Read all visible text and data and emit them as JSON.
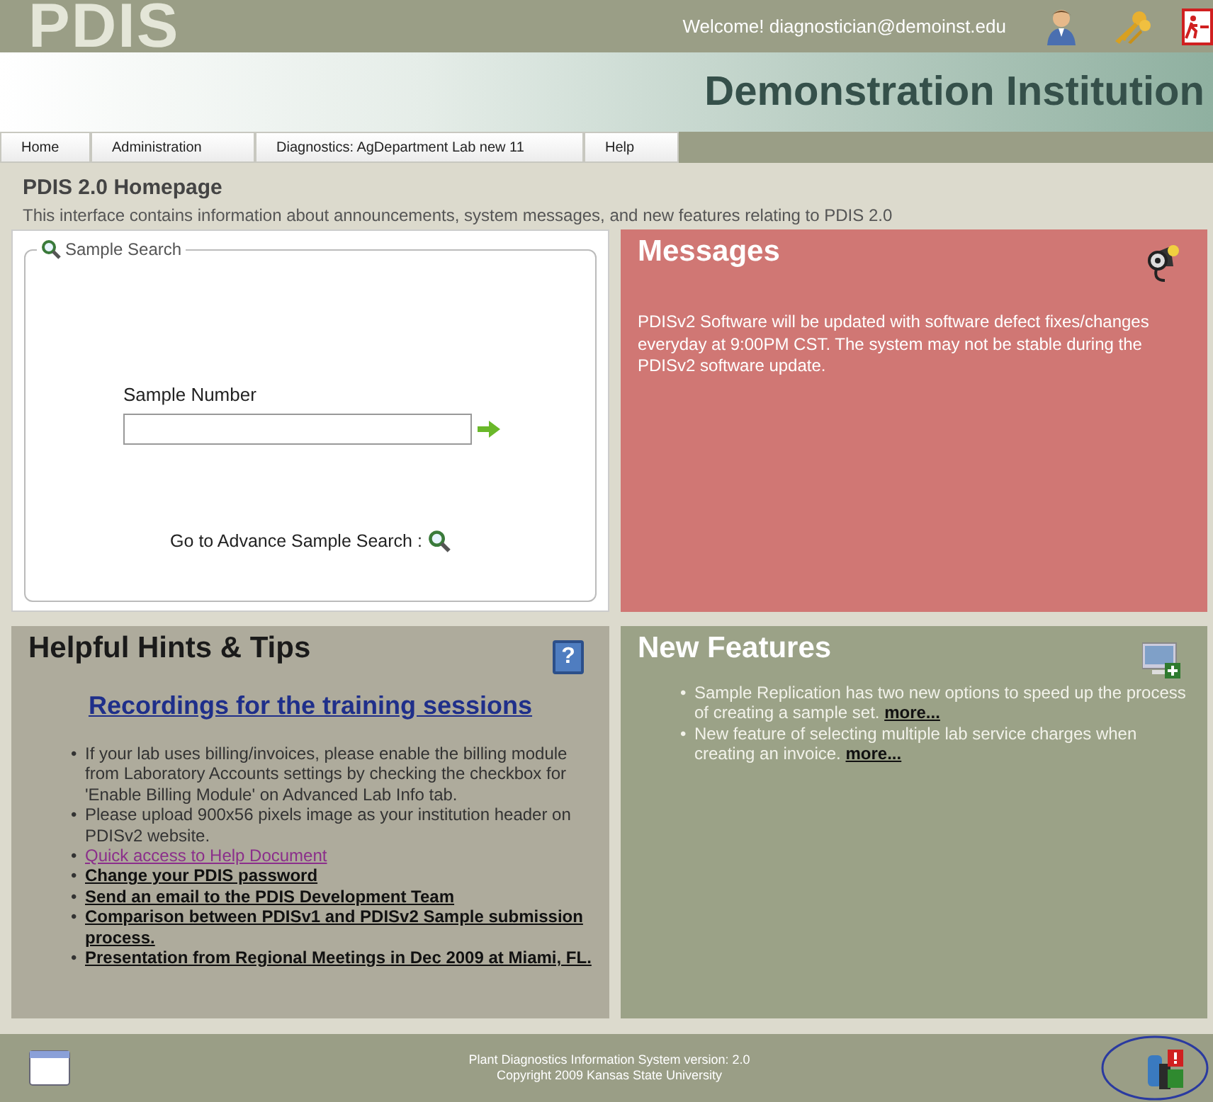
{
  "header": {
    "logo": "PDIS",
    "welcome": "Welcome! diagnostician@demoinst.edu",
    "institution": "Demonstration Institution"
  },
  "nav": [
    {
      "label": "Home",
      "selected": false
    },
    {
      "label": "Administration",
      "selected": false
    },
    {
      "label": "Diagnostics: AgDepartment Lab new 11",
      "selected": false
    },
    {
      "label": "Help",
      "selected": false
    }
  ],
  "page": {
    "title": "PDIS 2.0 Homepage",
    "description": "This interface contains information about announcements, system messages, and new features relating to PDIS 2.0"
  },
  "sample_search": {
    "legend": "Sample Search",
    "field_label": "Sample Number",
    "advance_link": "Go to Advance Sample Search :"
  },
  "messages": {
    "title": "Messages",
    "body": "PDISv2 Software will be updated with software defect fixes/changes everyday at 9:00PM CST. The system may not be stable during the PDISv2 software update."
  },
  "hints": {
    "title": "Helpful Hints & Tips",
    "help_glyph": "?",
    "bullet": "•",
    "heading_link": "Recordings for the training sessions",
    "items": [
      {
        "kind": "text",
        "text": "If your lab uses billing/invoices, please enable the billing module from Laboratory Accounts settings by checking the checkbox for 'Enable Billing Module' on Advanced Lab Info tab."
      },
      {
        "kind": "text",
        "text": "Please upload 900x56 pixels image as your institution header on PDISv2 website."
      },
      {
        "kind": "visited_link",
        "text": "Quick access to Help Document"
      },
      {
        "kind": "link",
        "text": "Change your PDIS password"
      },
      {
        "kind": "link",
        "text": "Send an email to the PDIS Development Team"
      },
      {
        "kind": "link",
        "text": "Comparison between PDISv1 and PDISv2 Sample submission process."
      },
      {
        "kind": "link",
        "text": "Presentation from Regional Meetings in Dec 2009 at Miami, FL."
      }
    ]
  },
  "new_features": {
    "title": "New Features",
    "bullet": "•",
    "items": [
      {
        "text": "Sample Replication has two new options to speed up the process of creating a sample set.",
        "link": "more..."
      },
      {
        "text": "New feature of selecting multiple lab service charges when creating an invoice.",
        "link": "more..."
      }
    ]
  },
  "footer": {
    "lines": [
      "Plant Diagnostics Information System version: 2.0",
      "Copyright 2009 Kansas State University"
    ]
  }
}
